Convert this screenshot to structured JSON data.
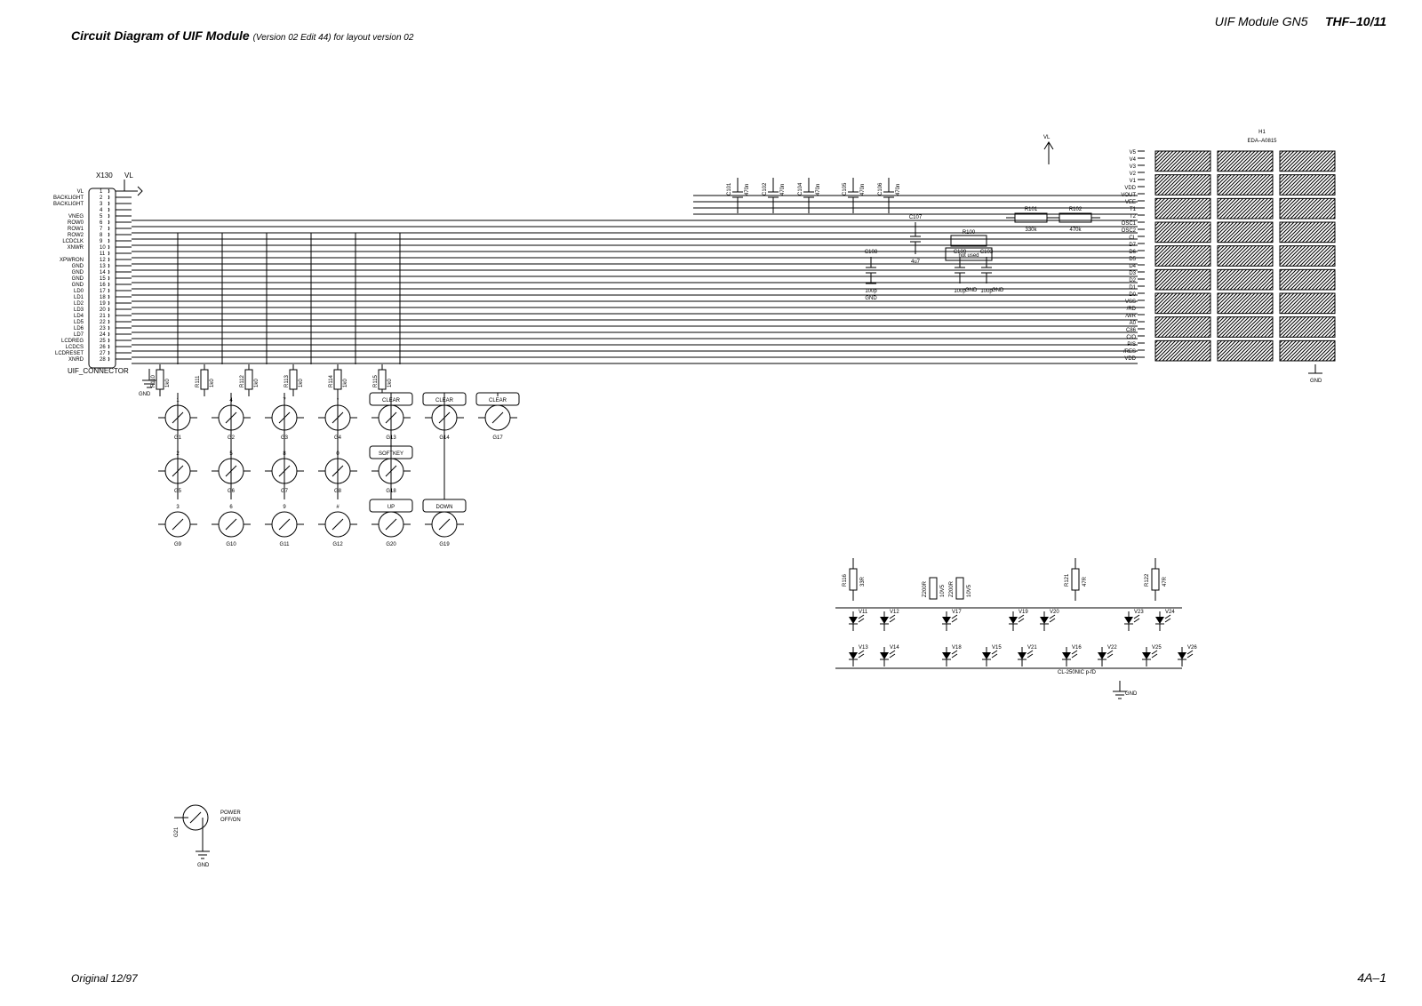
{
  "header": {
    "right_module": "UIF Module GN5",
    "right_doc": "THF–10/11",
    "title": "Circuit Diagram of UIF Module",
    "subtitle": "(Version 02 Edit 44) for layout version 02"
  },
  "footer": {
    "left": "Original 12/97",
    "right": "4A–1"
  },
  "connector": {
    "label_top": "X130",
    "net_top": "VL",
    "bottom_label": "UIF_CONNECTOR",
    "pins": [
      {
        "n": "1",
        "name": "VL"
      },
      {
        "n": "2",
        "name": "BACKLIGHT"
      },
      {
        "n": "3",
        "name": "BACKLIGHT"
      },
      {
        "n": "4",
        "name": ""
      },
      {
        "n": "5",
        "name": "VNEG"
      },
      {
        "n": "6",
        "name": "ROW0"
      },
      {
        "n": "7",
        "name": "ROW1"
      },
      {
        "n": "8",
        "name": "ROW2"
      },
      {
        "n": "9",
        "name": "LCDCLK"
      },
      {
        "n": "10",
        "name": "XNWR"
      },
      {
        "n": "11",
        "name": ""
      },
      {
        "n": "12",
        "name": "XPWRON"
      },
      {
        "n": "13",
        "name": "GND"
      },
      {
        "n": "14",
        "name": "GND"
      },
      {
        "n": "15",
        "name": "GND"
      },
      {
        "n": "16",
        "name": "GND"
      },
      {
        "n": "17",
        "name": "LD0"
      },
      {
        "n": "18",
        "name": "LD1"
      },
      {
        "n": "19",
        "name": "LD2"
      },
      {
        "n": "20",
        "name": "LD3"
      },
      {
        "n": "21",
        "name": "LD4"
      },
      {
        "n": "22",
        "name": "LD5"
      },
      {
        "n": "23",
        "name": "LD6"
      },
      {
        "n": "24",
        "name": "LD7"
      },
      {
        "n": "25",
        "name": "LCDREG"
      },
      {
        "n": "26",
        "name": "LCDCS"
      },
      {
        "n": "27",
        "name": "LCDRESET"
      },
      {
        "n": "28",
        "name": "XNRD"
      }
    ]
  },
  "resistors_pulldown": [
    {
      "ref": "R110",
      "val": "1k0"
    },
    {
      "ref": "R111",
      "val": "1k0"
    },
    {
      "ref": "R112",
      "val": "1k0"
    },
    {
      "ref": "R113",
      "val": "1k0"
    },
    {
      "ref": "R114",
      "val": "1k0"
    },
    {
      "ref": "R115",
      "val": "1k0"
    }
  ],
  "keypad": {
    "rows": [
      [
        {
          "top": "1",
          "ref": "G1"
        },
        {
          "top": "4",
          "ref": "G2"
        },
        {
          "top": "7",
          "ref": "G3"
        },
        {
          "top": "*",
          "ref": "G4"
        },
        {
          "top": "CLEAR",
          "ref": "G13"
        },
        {
          "top": "CLEAR",
          "ref": "G14"
        },
        {
          "top": "CLEAR",
          "ref": "G17"
        }
      ],
      [
        {
          "top": "2",
          "ref": "G5"
        },
        {
          "top": "5",
          "ref": "G6"
        },
        {
          "top": "8",
          "ref": "G7"
        },
        {
          "top": "0",
          "ref": "G8"
        },
        {
          "top": "SOFTKEY",
          "ref": "G18"
        }
      ],
      [
        {
          "top": "3",
          "ref": "G9"
        },
        {
          "top": "6",
          "ref": "G10"
        },
        {
          "top": "9",
          "ref": "G11"
        },
        {
          "top": "#",
          "ref": "G12"
        },
        {
          "top": "UP",
          "ref": "G20"
        },
        {
          "top": "DOWN",
          "ref": "G19"
        }
      ]
    ]
  },
  "power_switch": {
    "ref": "G21",
    "label": "POWER\nOFF/ON"
  },
  "caps_top": [
    {
      "ref": "C101",
      "val": "470n"
    },
    {
      "ref": "C102",
      "val": "470n"
    },
    {
      "ref": "C104",
      "val": "470n"
    },
    {
      "ref": "C105",
      "val": "470n"
    },
    {
      "ref": "C106",
      "val": "470n"
    }
  ],
  "group_right_top": {
    "r100": {
      "ref": "R100",
      "note": "not used"
    },
    "r101": {
      "ref": "R101",
      "val": "330k"
    },
    "r102": {
      "ref": "R102",
      "val": "470k"
    },
    "c107": {
      "ref": "C107",
      "val": "4u7"
    },
    "c108": {
      "ref": "C108",
      "val": "100p"
    },
    "c109": {
      "ref": "C109",
      "val": "100p"
    },
    "c103": {
      "ref": "C103",
      "val": "100p"
    }
  },
  "lcd": {
    "ref": "H1",
    "part": "EDA–A0815",
    "pins": [
      "V5",
      "V4",
      "V3",
      "V2",
      "V1",
      "VDD",
      "VOUT",
      "VEE",
      "T1",
      "T2",
      "OSC1",
      "OSC2",
      "CL",
      "D7",
      "D6",
      "D5",
      "D4",
      "D3",
      "D2",
      "D1",
      "D0",
      "VSS",
      "/RD",
      "/WR",
      "A0",
      "C86",
      "C/O",
      "P/S",
      "/RES",
      "VDD"
    ]
  },
  "led_block": {
    "r116": {
      "ref": "R116",
      "val": "33R"
    },
    "r121": {
      "ref": "R121",
      "val": "47R"
    },
    "r122": {
      "ref": "R122",
      "val": "47R"
    },
    "pairs": [
      {
        "ref": "Z200R",
        "val": "10V5"
      },
      {
        "ref": "Z200R",
        "val": "10V5"
      }
    ],
    "leds": [
      "V11",
      "V12",
      "V17",
      "V19",
      "V20",
      "V23",
      "V24",
      "V13",
      "V14",
      "V18",
      "V15",
      "V21",
      "V16",
      "V22",
      "V25",
      "V26"
    ],
    "note": "CL-250NIC p-fD"
  }
}
